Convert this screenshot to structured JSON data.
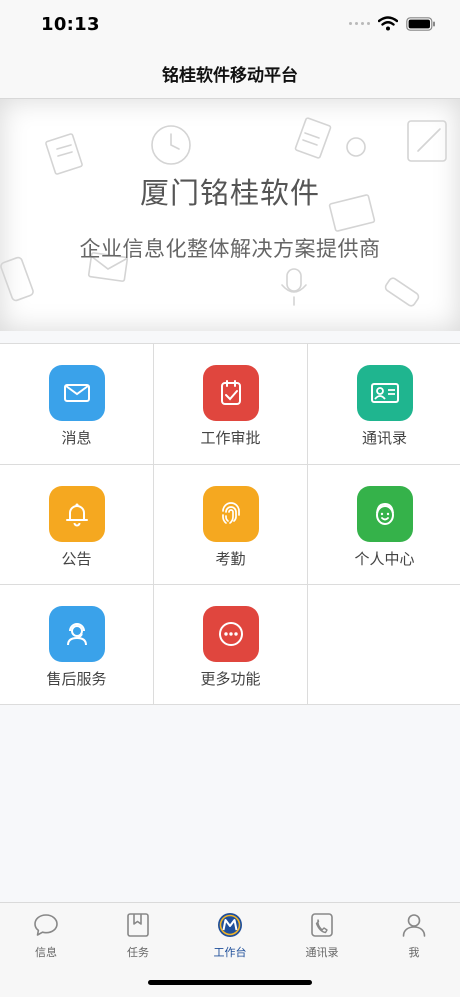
{
  "status_bar": {
    "time": "10:13"
  },
  "nav": {
    "title": "铭桂软件移动平台"
  },
  "banner": {
    "title": "厦门铭桂软件",
    "subtitle": "企业信息化整体解决方案提供商"
  },
  "grid": {
    "items": [
      {
        "label": "消息",
        "icon": "envelope-icon",
        "color": "#3aa2ea"
      },
      {
        "label": "工作审批",
        "icon": "approval-icon",
        "color": "#e0463e"
      },
      {
        "label": "通讯录",
        "icon": "contact-card-icon",
        "color": "#1fb58f"
      },
      {
        "label": "公告",
        "icon": "bell-icon",
        "color": "#f5a820"
      },
      {
        "label": "考勤",
        "icon": "fingerprint-icon",
        "color": "#f5a820"
      },
      {
        "label": "个人中心",
        "icon": "face-icon",
        "color": "#35b24a"
      },
      {
        "label": "售后服务",
        "icon": "headset-agent-icon",
        "color": "#3aa2ea"
      },
      {
        "label": "更多功能",
        "icon": "more-dots-icon",
        "color": "#e0463e"
      }
    ]
  },
  "tab_bar": {
    "active": "工作台",
    "active_color": "#1f4f9a",
    "items": [
      {
        "label": "信息",
        "icon": "chat-bubble-icon"
      },
      {
        "label": "任务",
        "icon": "bookmark-book-icon"
      },
      {
        "label": "工作台",
        "icon": "brand-logo-icon"
      },
      {
        "label": "通讯录",
        "icon": "phone-icon"
      },
      {
        "label": "我",
        "icon": "person-icon"
      }
    ]
  }
}
